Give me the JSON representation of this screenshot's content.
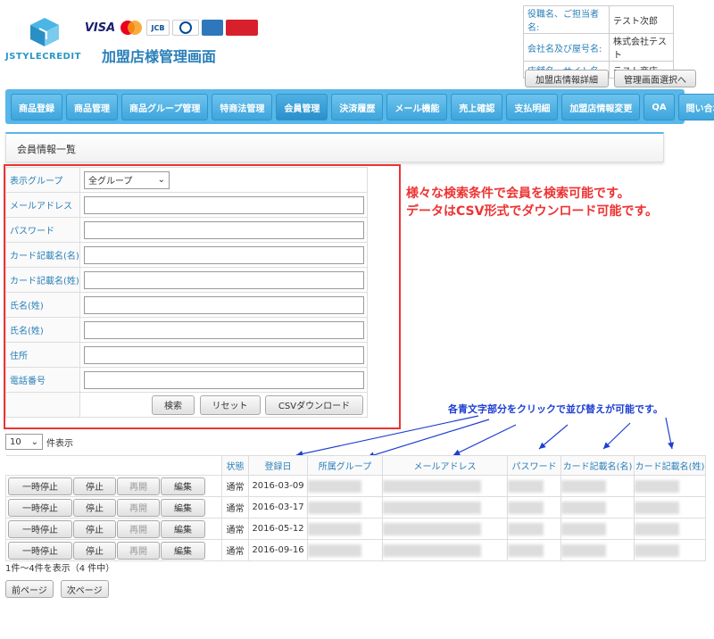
{
  "header": {
    "logo_text": "JSTYLECREDIT",
    "site_title": "加盟店様管理画面",
    "cards": [
      "VISA",
      "MasterCard",
      "JCB",
      "Diners Club",
      "AMEX",
      "UnionPay 银联"
    ],
    "info": [
      {
        "label": "役職名、ご担当者名:",
        "value": "テスト次郎"
      },
      {
        "label": "会社名及び屋号名:",
        "value": "株式会社テスト"
      },
      {
        "label": "店舗名・サイト名:",
        "value": "テスト商店"
      }
    ],
    "btn_shop_info": "加盟店情報詳細",
    "btn_switch": "管理画面選択へ"
  },
  "nav": [
    "商品登録",
    "商品管理",
    "商品グループ管理",
    "特商法管理",
    "会員管理",
    "決済履歴",
    "メール機能",
    "売上確認",
    "支払明細",
    "加盟店情報変更",
    "QA",
    "問い合わせ"
  ],
  "section_title": "会員情報一覧",
  "form": {
    "group_label": "表示グループ",
    "group_value": "全グループ",
    "fields": [
      "メールアドレス",
      "パスワード",
      "カード記載名(名)",
      "カード記載名(姓)",
      "氏名(姓)",
      "氏名(姓)",
      "住所",
      "電話番号"
    ],
    "search": "検索",
    "reset": "リセット",
    "csv": "CSVダウンロード"
  },
  "notes": {
    "line1": "様々な検索条件で会員を検索可能です。",
    "line2": "データはCSV形式でダウンロード可能です。",
    "sort_hint": "各青文字部分をクリックで並び替えが可能です。"
  },
  "page_size": {
    "value": "10",
    "suffix": "件表示"
  },
  "table": {
    "columns": [
      "状態",
      "登録日",
      "所属グループ",
      "メールアドレス",
      "パスワード",
      "カード記載名(名)",
      "カード記載名(姓)"
    ],
    "row_buttons": [
      "一時停止",
      "停止",
      "再開",
      "編集"
    ],
    "rows": [
      {
        "status": "通常",
        "date": "2016-03-09"
      },
      {
        "status": "通常",
        "date": "2016-03-17"
      },
      {
        "status": "通常",
        "date": "2016-05-12"
      },
      {
        "status": "通常",
        "date": "2016-09-16"
      }
    ]
  },
  "count_text": "1件～4件を表示（4 件中）",
  "pager": {
    "prev": "前ページ",
    "next": "次ページ"
  }
}
